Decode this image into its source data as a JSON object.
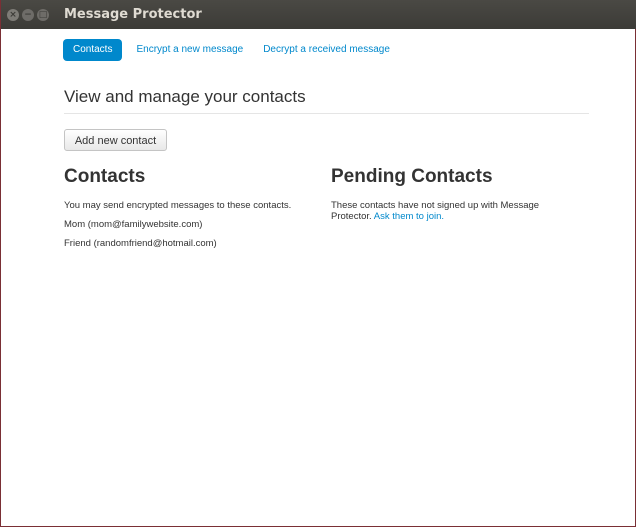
{
  "window": {
    "title": "Message Protector",
    "close_glyph": "×",
    "min_glyph": "−",
    "max_glyph": "□"
  },
  "nav": {
    "items": [
      {
        "label": "Contacts",
        "active": true
      },
      {
        "label": "Encrypt a new message",
        "active": false
      },
      {
        "label": "Decrypt a received message",
        "active": false
      }
    ]
  },
  "page": {
    "heading": "View and manage your contacts",
    "add_button_label": "Add new contact"
  },
  "contacts": {
    "title": "Contacts",
    "description": "You may send encrypted messages to these contacts.",
    "items": [
      "Mom (mom@familywebsite.com)",
      "Friend (randomfriend@hotmail.com)"
    ]
  },
  "pending": {
    "title": "Pending Contacts",
    "description": "These contacts have not signed up with Message Protector.",
    "link_text": "Ask them to join."
  },
  "colors": {
    "accent": "#0088cc",
    "titlebar": "#3c3b37",
    "window_border": "#7a2f35"
  }
}
